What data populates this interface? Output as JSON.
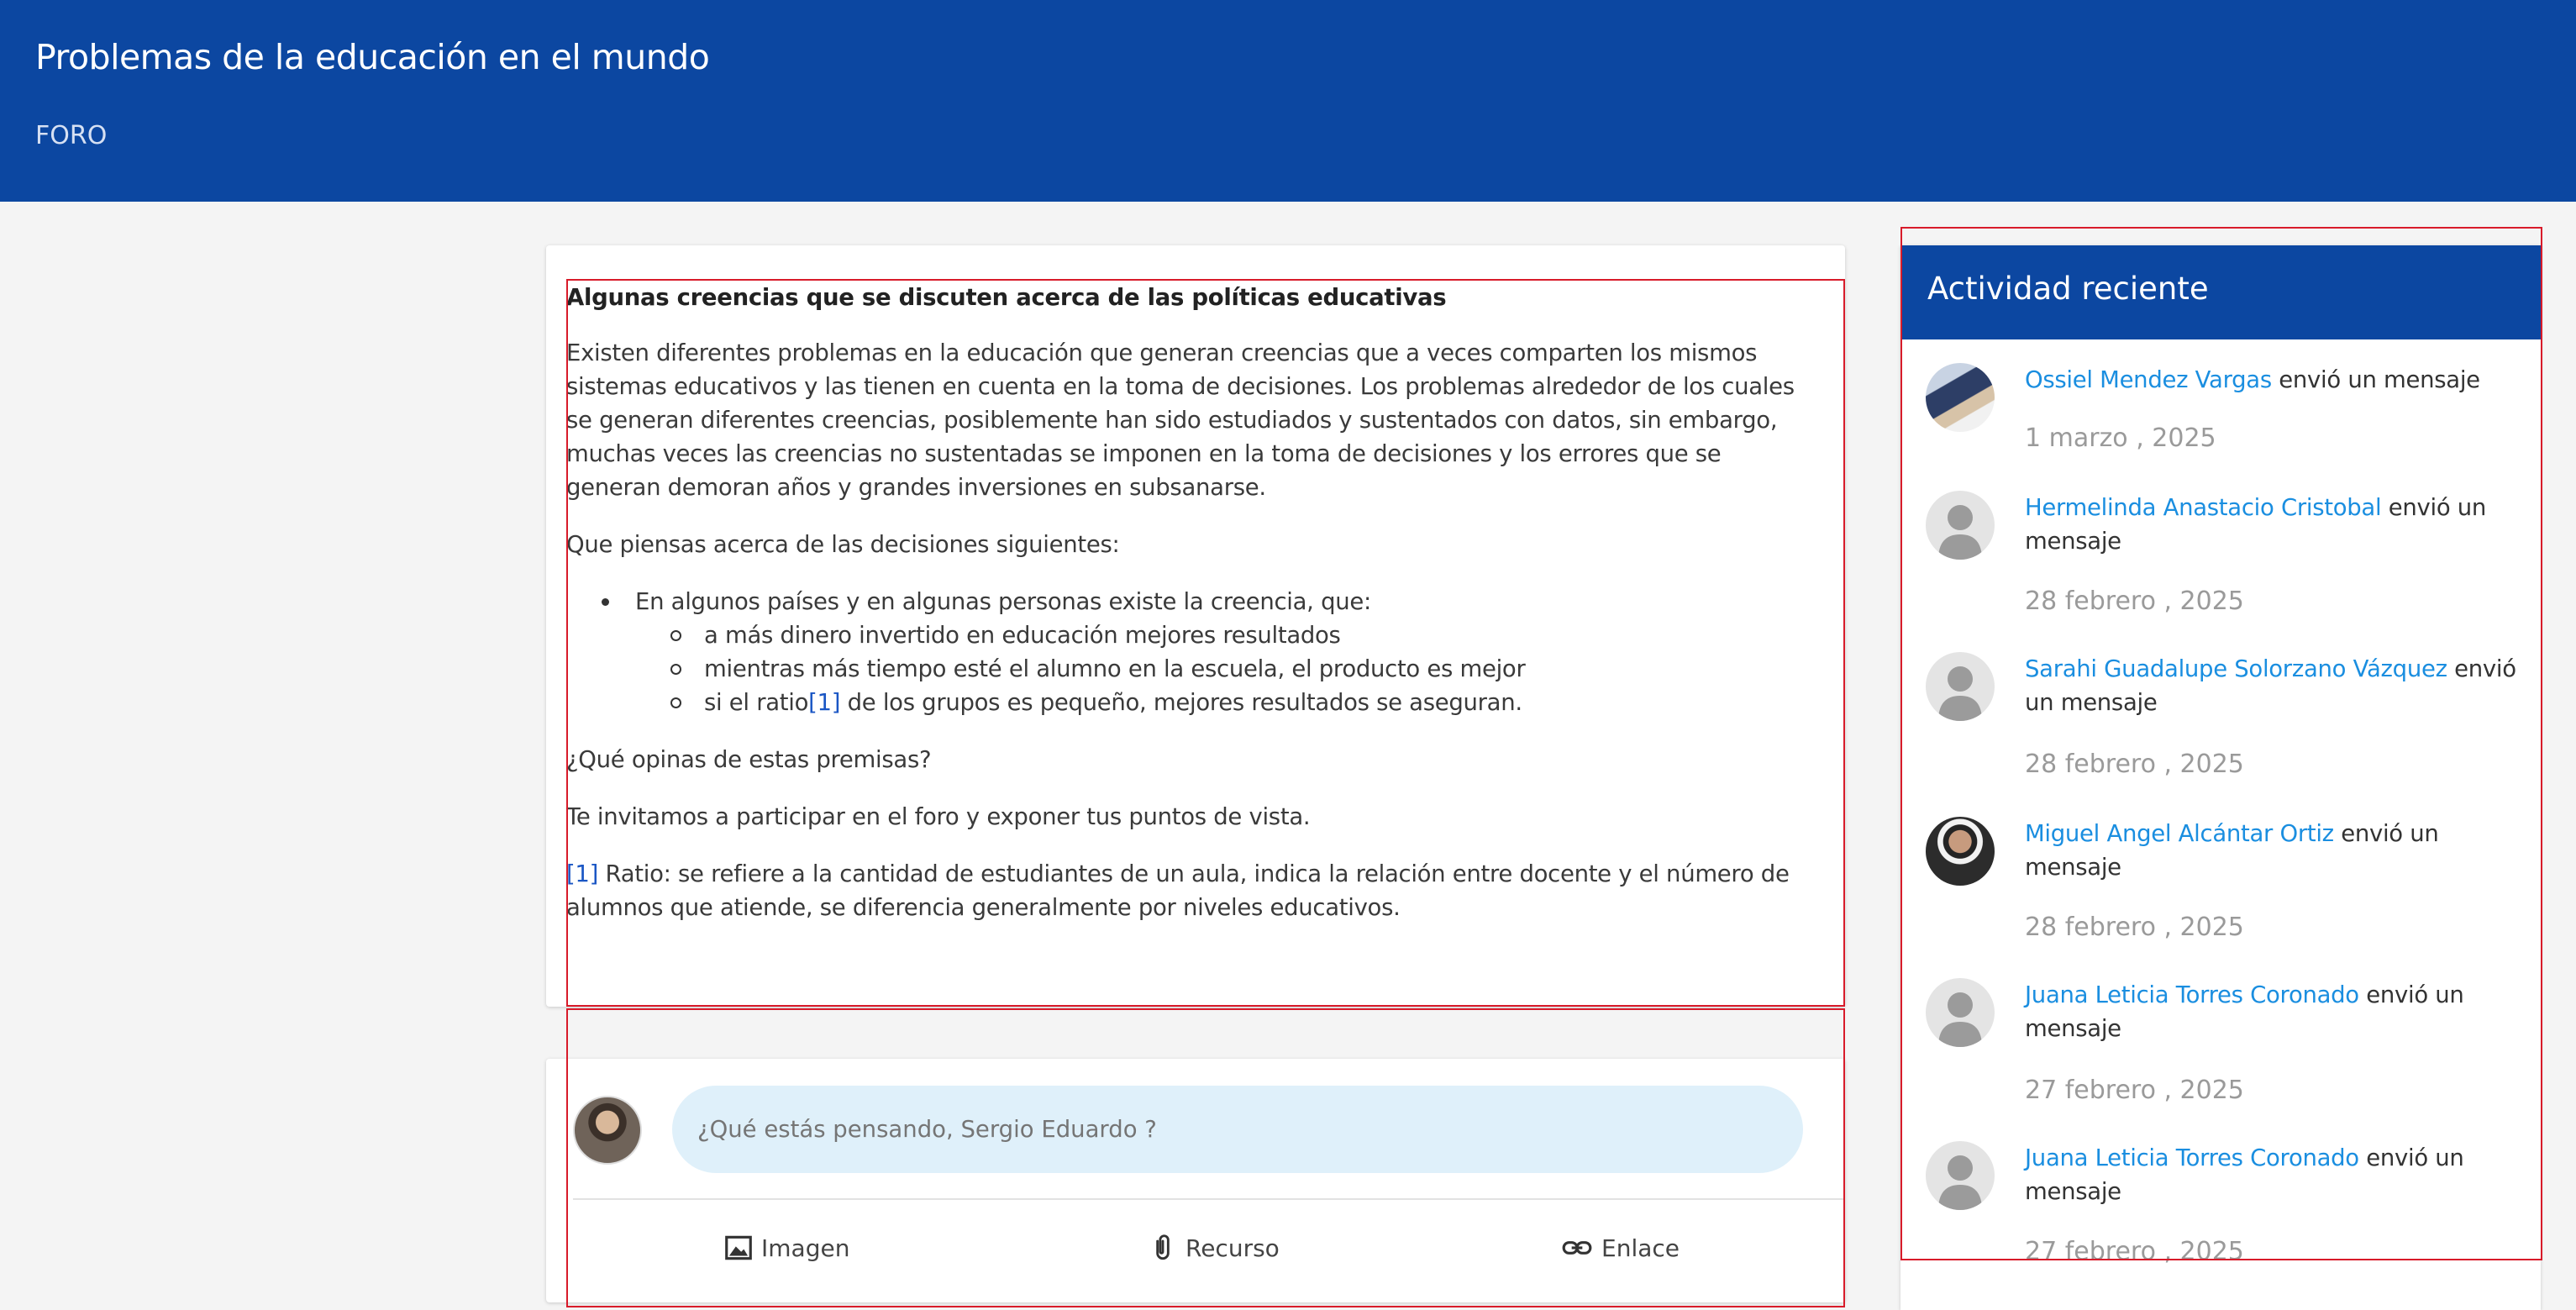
{
  "header": {
    "title": "Problemas de la educación en el mundo",
    "subtitle": "FORO"
  },
  "post": {
    "title": "Algunas creencias que se discuten acerca de las políticas educativas",
    "intro": " Existen diferentes problemas en la educación que generan creencias que a veces comparten los mismos sistemas educativos y las tienen en cuenta en la toma de decisiones. Los problemas alrededor de los cuales se generan diferentes creencias, posiblemente han sido estudiados y sustentados con datos, sin embargo, muchas veces las creencias no sustentadas se imponen en la toma de decisiones y los errores que se generan demoran años y grandes inversiones en subsanarse.",
    "question_intro": "Que piensas acerca de las decisiones siguientes:",
    "bullet": "En algunos países y en algunas personas existe la creencia, que:",
    "sub_bullets": {
      "one": "a más dinero invertido en educación mejores resultados",
      "two": "mientras más tiempo esté el alumno en la escuela, el producto es mejor",
      "three_before": "si el ratio",
      "three_ref": "[1]",
      "three_after": " de los grupos es pequeño, mejores resultados se aseguran."
    },
    "question": "¿Qué opinas de estas premisas?",
    "invite": "Te invitamos a participar en el foro y exponer tus puntos de vista.",
    "footnote_ref": "[1]",
    "footnote_text": " Ratio: se refiere a la cantidad de estudiantes de un aula, indica la relación entre docente y el número de alumnos que atiende, se diferencia generalmente por niveles educativos."
  },
  "compose": {
    "placeholder": "¿Qué estás pensando, Sergio Eduardo ?",
    "actions": {
      "image": "Imagen",
      "resource": "Recurso",
      "link": "Enlace"
    }
  },
  "activity": {
    "title": "Actividad reciente",
    "items": [
      {
        "name": "Ossiel Mendez Vargas",
        "action": " envió un mensaje",
        "date": "1 marzo , 2025"
      },
      {
        "name": "Hermelinda Anastacio Cristobal",
        "action": " envió un mensaje",
        "date": "28 febrero , 2025"
      },
      {
        "name": "Sarahi Guadalupe Solorzano Vázquez",
        "action": " envió un mensaje",
        "date": "28 febrero , 2025"
      },
      {
        "name": "Miguel Angel Alcántar Ortiz",
        "action": " envió un mensaje",
        "date": "28 febrero , 2025"
      },
      {
        "name": "Juana Leticia Torres Coronado",
        "action": " envió un mensaje",
        "date": "27 febrero , 2025"
      },
      {
        "name": "Juana Leticia Torres Coronado",
        "action": " envió un mensaje",
        "date": "27 febrero , 2025"
      }
    ]
  },
  "colors": {
    "brand": "#0c47a1",
    "link": "#1a8ee0",
    "outline": "#d81b2a",
    "compose_bg": "#dff0fa"
  }
}
